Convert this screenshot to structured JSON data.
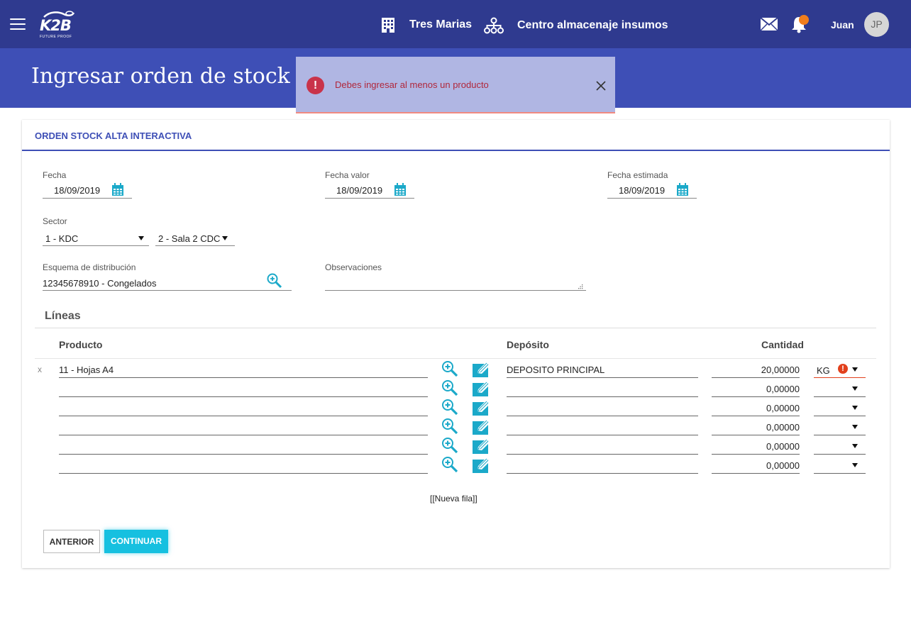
{
  "header": {
    "logo_text": "K2B",
    "logo_tagline": "FUTURE PROOF",
    "company": "Tres Marias",
    "warehouse": "Centro almacenaje insumos",
    "user_name": "Juan",
    "user_initials": "JP",
    "notification_dot_color": "#f07d1c",
    "bar_color": "#2f3a8f"
  },
  "page": {
    "title": "Ingresar orden de stock"
  },
  "toast": {
    "message": "Debes ingresar al menos un producto",
    "icon": "error-icon"
  },
  "card": {
    "title": "ORDEN STOCK ALTA INTERACTIVA",
    "fecha_label": "Fecha",
    "fecha_value": "18/09/2019",
    "fecha_valor_label": "Fecha valor",
    "fecha_valor_value": "18/09/2019",
    "fecha_estimada_label": "Fecha estimada",
    "fecha_estimada_value": "18/09/2019",
    "sector_label": "Sector",
    "sector_value": "1 - KDC",
    "subsector_value": "2 - Sala 2 CDC",
    "esquema_label": "Esquema de distribución",
    "esquema_value": "12345678910 - Congelados",
    "observaciones_label": "Observaciones",
    "observaciones_value": ""
  },
  "lines": {
    "title": "Líneas",
    "columns": {
      "producto": "Producto",
      "deposito": "Depósito",
      "cantidad": "Cantidad"
    },
    "rows": [
      {
        "remove": "x",
        "producto": "11 - Hojas A4",
        "deposito": "DEPOSITO PRINCIPAL",
        "cantidad": "20,00000",
        "unidad": "KG"
      },
      {
        "remove": "",
        "producto": "",
        "deposito": "",
        "cantidad": "0,00000",
        "unidad": ""
      },
      {
        "remove": "",
        "producto": "",
        "deposito": "",
        "cantidad": "0,00000",
        "unidad": ""
      },
      {
        "remove": "",
        "producto": "",
        "deposito": "",
        "cantidad": "0,00000",
        "unidad": ""
      },
      {
        "remove": "",
        "producto": "",
        "deposito": "",
        "cantidad": "0,00000",
        "unidad": ""
      },
      {
        "remove": "",
        "producto": "",
        "deposito": "",
        "cantidad": "0,00000",
        "unidad": ""
      }
    ],
    "new_row": "[[Nueva fila]]"
  },
  "buttons": {
    "prev": "ANTERIOR",
    "next": "CONTINUAR"
  },
  "colors": {
    "accent": "#3e4fb6",
    "primary_button": "#16c0e0",
    "error": "#c9334a",
    "icon_teal": "#1ba9c9"
  }
}
